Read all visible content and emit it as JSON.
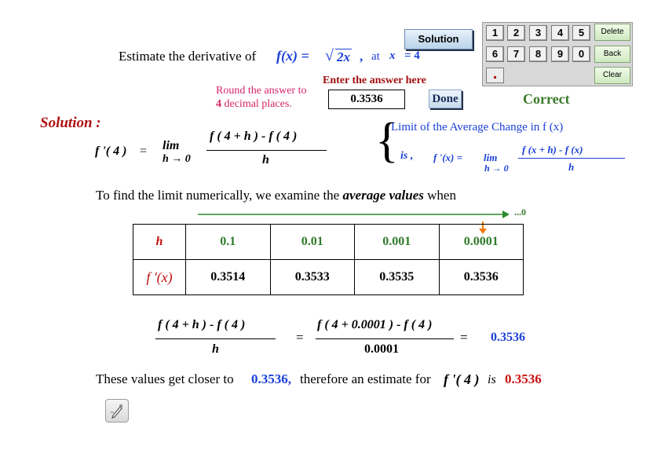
{
  "question": {
    "prefix": "Estimate the derivative of",
    "func": "f(x) =",
    "sqrt_arg": "2x",
    "comma": ",",
    "at": "at",
    "xvar": "x",
    "eq": "= 4"
  },
  "buttons": {
    "solution": "Solution",
    "done": "Done"
  },
  "keypad": {
    "digits_row1": [
      "1",
      "2",
      "3",
      "4",
      "5"
    ],
    "digits_row2": [
      "6",
      "7",
      "8",
      "9",
      "0"
    ],
    "delete": "Delete",
    "back": "Back",
    "clear": "Clear"
  },
  "entry": {
    "prompt": "Enter the answer here",
    "round_line1": "Round the answer to",
    "round_num": "4",
    "round_line2": "decimal places.",
    "value": "0.3536",
    "status": "Correct"
  },
  "solution": {
    "heading": "Solution :",
    "fprime4": "f '( 4 )",
    "equals": "=",
    "lim": "lim",
    "h_to_0": "h → 0",
    "numerator": "f ( 4 + h )  -  f ( 4 )",
    "denominator": "h",
    "note_title": "Limit of the Average Change in f (x)",
    "note_is": "is ,",
    "note_fpx": "f '(x)  =",
    "note_lim": "lim",
    "note_hto0": "h → 0",
    "note_num": "f  (x + h)  -  f  (x)",
    "note_den": "h"
  },
  "explain": {
    "text_a": "To find the limit numerically, we examine the",
    "text_b": "average values",
    "text_c": "when",
    "arrow_label": "...0"
  },
  "table": {
    "row1_label": "h",
    "h_values": [
      "0.1",
      "0.01",
      "0.001",
      "0.0001"
    ],
    "row2_label": "f '(x)",
    "f_values": [
      "0.3514",
      "0.3533",
      "0.3535",
      "0.3536"
    ]
  },
  "bottom_eq": {
    "left_num": "f ( 4 + h )  -  f ( 4 )",
    "left_den": "h",
    "eq1": "=",
    "mid_num": "f ( 4 + 0.0001 ) -  f ( 4 )",
    "mid_den": "0.0001",
    "eq2": "=",
    "result": "0.3536"
  },
  "conclusion": {
    "a": "These values get closer to",
    "val": "0.3536,",
    "b": "therefore an estimate for",
    "fp": "f '( 4 )",
    "is": "is",
    "ans": "0.3536"
  },
  "icons": {
    "bottom_icon": "edit-pencil-icon"
  },
  "colors": {
    "blue": "#1a3fd6",
    "red": "#cc1111",
    "green": "#3a7a2a",
    "pink": "#d6246a"
  }
}
